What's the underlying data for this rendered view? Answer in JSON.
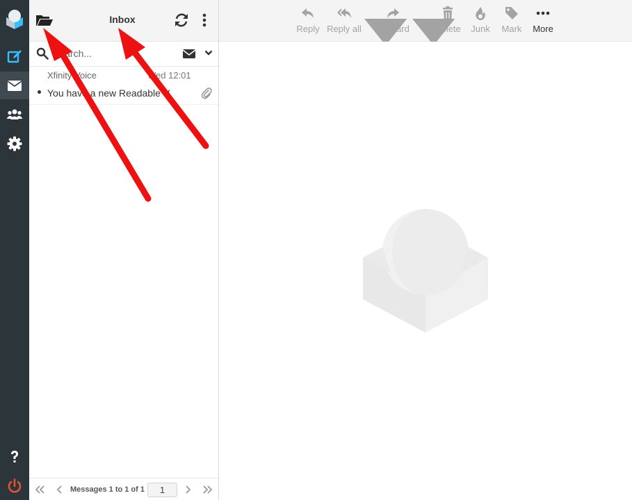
{
  "list": {
    "title": "Inbox",
    "search_placeholder": "Search...",
    "messages": [
      {
        "from": "Xfinity Voice",
        "date": "Wed 12:01",
        "subject": "You have a new Readable V"
      }
    ]
  },
  "pager": {
    "count_text": "Messages 1 to 1 of 1",
    "page": "1"
  },
  "toolbar": {
    "reply": "Reply",
    "reply_all": "Reply all",
    "forward": "Forward",
    "delete": "Delete",
    "junk": "Junk",
    "mark": "Mark",
    "more": "More"
  },
  "colors": {
    "rail_bg": "#2c363a",
    "accent": "#37beff",
    "danger": "#e0533a",
    "arrow": "#ee1111"
  },
  "icons": {
    "rail": [
      "logo-icon",
      "compose-icon",
      "mail-icon",
      "contacts-icon",
      "settings-icon",
      "help-icon",
      "logout-icon"
    ]
  }
}
